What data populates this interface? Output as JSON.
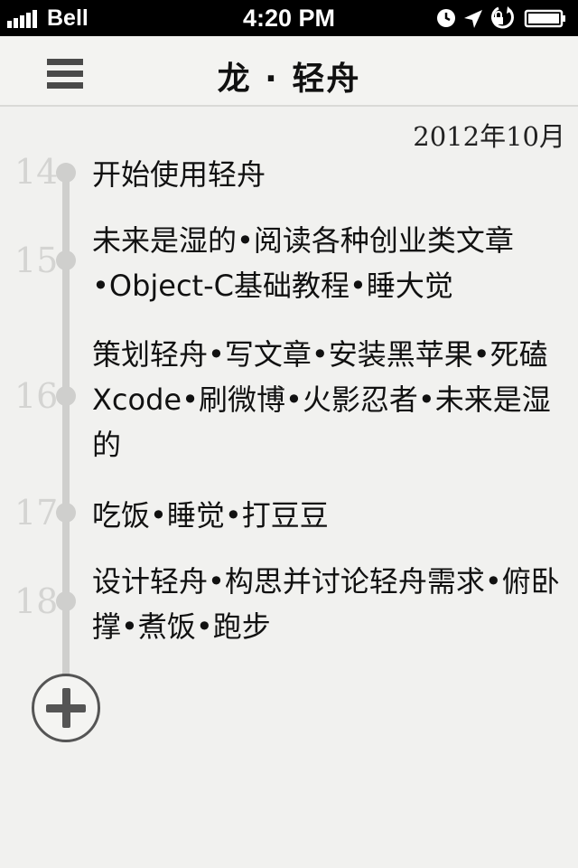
{
  "status_bar": {
    "carrier": "Bell",
    "time": "4:20 PM",
    "icons": [
      "signal-icon",
      "alarm-icon",
      "location-icon",
      "rotation-lock-icon",
      "battery-icon"
    ]
  },
  "nav": {
    "title": "龙 · 轻舟",
    "menu_icon": "menu-icon"
  },
  "timeline": {
    "month": "2012年10月",
    "entries": [
      {
        "day": "14",
        "text": "开始使用轻舟"
      },
      {
        "day": "15",
        "text": "未来是湿的•阅读各种创业类文章•Object-C基础教程•睡大觉"
      },
      {
        "day": "16",
        "text": "策划轻舟•写文章•安装黑苹果•死磕Xcode•刷微博•火影忍者•未来是湿的"
      },
      {
        "day": "17",
        "text": "吃饭•睡觉•打豆豆"
      },
      {
        "day": "18",
        "text": "设计轻舟•构思并讨论轻舟需求•俯卧撑•煮饭•跑步"
      }
    ]
  },
  "add_button": {
    "icon": "plus-icon"
  },
  "colors": {
    "background": "#f1f1ef",
    "timeline": "#cfcfcd",
    "day_number": "#d4d4d2",
    "status_bar": "#000000"
  }
}
